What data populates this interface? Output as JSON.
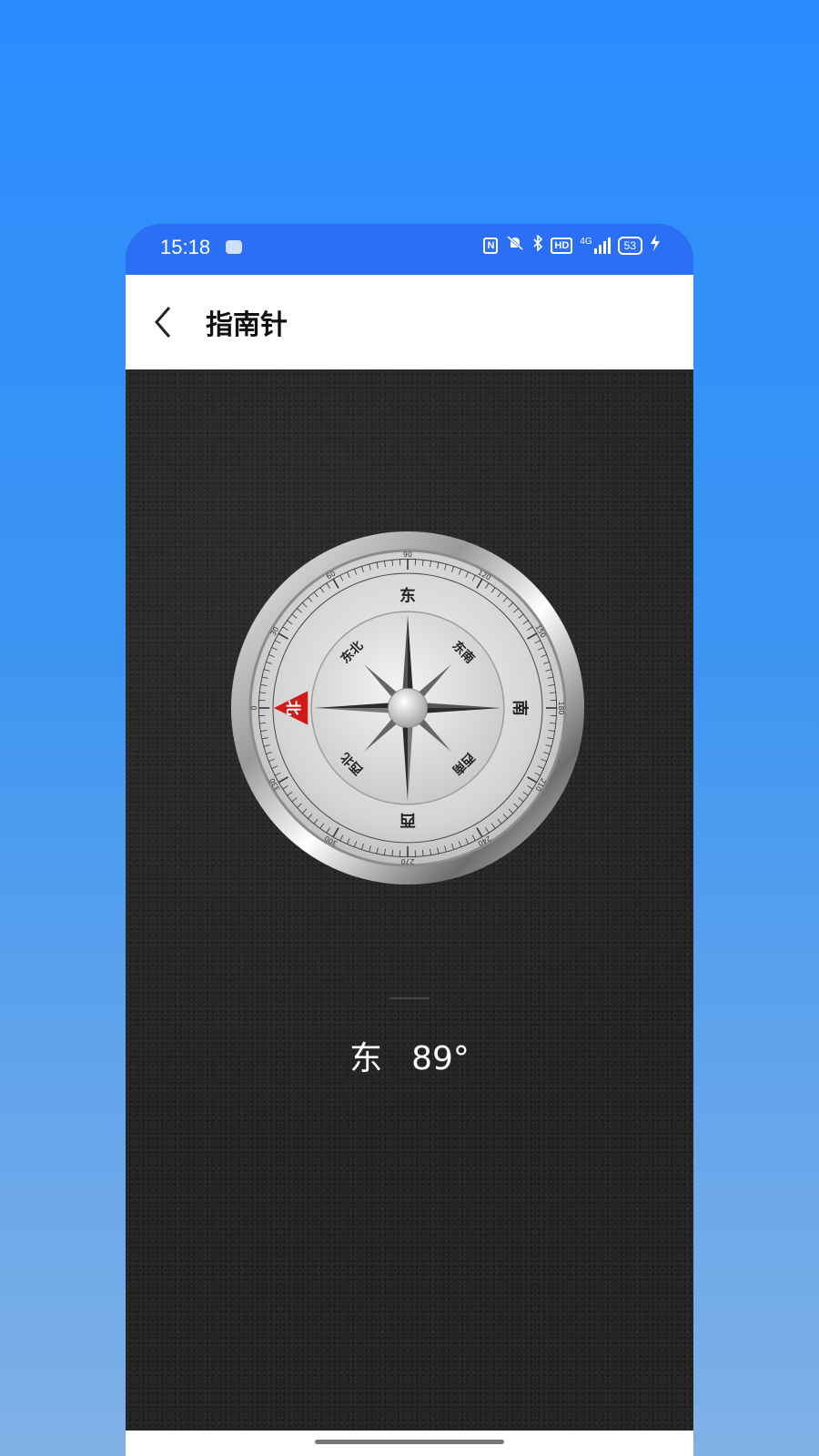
{
  "status_bar": {
    "time": "15:18",
    "icons": [
      "nfc-icon",
      "mute-vibrate-icon",
      "bluetooth-icon",
      "hd-icon",
      "4g-signal-icon",
      "battery-icon",
      "charging-icon"
    ],
    "nfc": "N",
    "hd": "HD",
    "network": "4G",
    "battery": "53"
  },
  "header": {
    "title": "指南针",
    "back_icon": "chevron-left-icon"
  },
  "compass": {
    "heading_degrees": 89,
    "labels": {
      "north": "北",
      "east": "东",
      "south": "南",
      "west": "西",
      "northeast": "东北",
      "southeast": "东南",
      "southwest": "西南",
      "northwest": "西北"
    },
    "degree_ticks": [
      "0",
      "30",
      "60",
      "90",
      "120",
      "150",
      "180",
      "210",
      "240",
      "270",
      "300",
      "330"
    ],
    "north_marker_color": "#d11a1a"
  },
  "reading": {
    "direction": "东",
    "degrees": "89°"
  },
  "colors": {
    "accent": "#2a6ff5",
    "background_top": "#2a8cff",
    "background_bottom": "#7fb1e6"
  }
}
